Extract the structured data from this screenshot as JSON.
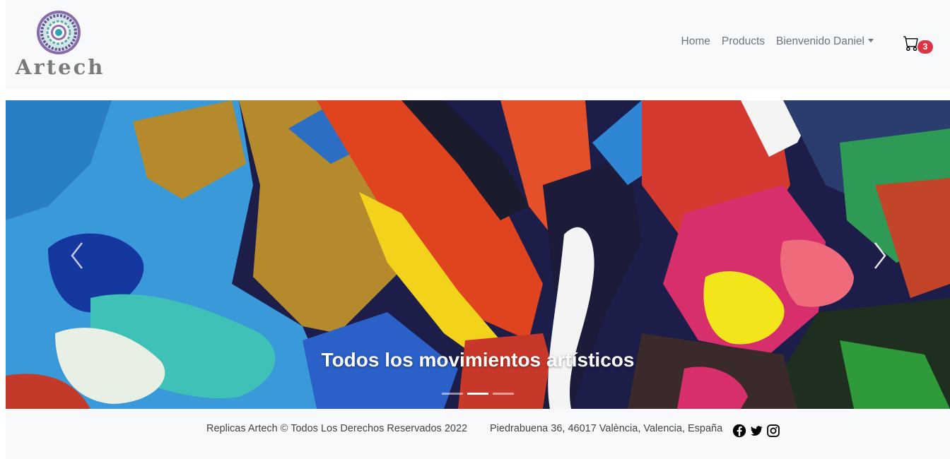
{
  "brand": {
    "logo_text": "Artech"
  },
  "nav": {
    "home": "Home",
    "products": "Products",
    "user_menu": "Bienvenido Daniel"
  },
  "cart": {
    "count": "3",
    "icon": "cart-icon"
  },
  "carousel": {
    "caption": "Todos los movimientos artísticos",
    "slides_count": 3,
    "active_slide": 2
  },
  "footer": {
    "copyright": "Replicas Artech © Todos Los Derechos Reservados 2022",
    "address": "Piedrabuena 36, 46017 València, Valencia, España",
    "social": [
      "facebook-icon",
      "twitter-icon",
      "instagram-icon"
    ]
  },
  "colors": {
    "navbar_bg": "#f8f9fa",
    "badge": "#dc3545",
    "link": "#6c757d"
  }
}
